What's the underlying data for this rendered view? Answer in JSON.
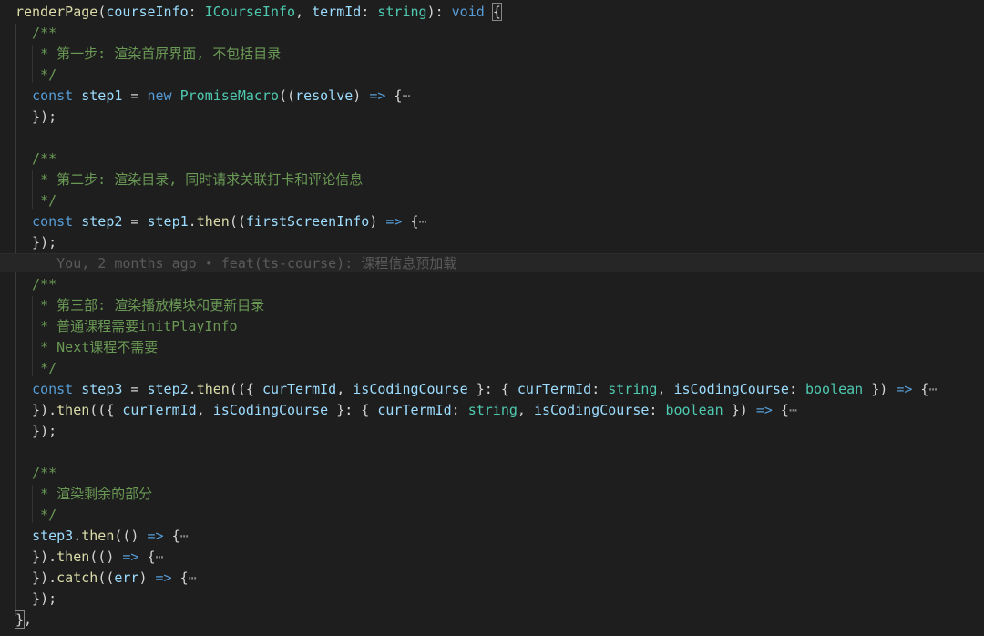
{
  "code": {
    "lines": [
      [
        {
          "t": "renderPage",
          "c": "fn"
        },
        {
          "t": "(",
          "c": "pu"
        },
        {
          "t": "courseInfo",
          "c": "vr"
        },
        {
          "t": ": ",
          "c": "pu"
        },
        {
          "t": "ICourseInfo",
          "c": "ty"
        },
        {
          "t": ", ",
          "c": "pu"
        },
        {
          "t": "termId",
          "c": "vr"
        },
        {
          "t": ": ",
          "c": "pu"
        },
        {
          "t": "string",
          "c": "ty"
        },
        {
          "t": "): ",
          "c": "pu"
        },
        {
          "t": "void",
          "c": "kw"
        },
        {
          "t": " ",
          "c": "pu"
        },
        {
          "t": "{",
          "c": "pu brace-match"
        }
      ],
      [
        {
          "t": "  /**",
          "c": "cm"
        }
      ],
      [
        {
          "t": "   * 第一步: 渲染首屏界面, 不包括目录",
          "c": "cm"
        }
      ],
      [
        {
          "t": "   */",
          "c": "cm"
        }
      ],
      [
        {
          "t": "  ",
          "c": "pu"
        },
        {
          "t": "const",
          "c": "kw"
        },
        {
          "t": " ",
          "c": "pu"
        },
        {
          "t": "step1",
          "c": "vr"
        },
        {
          "t": " = ",
          "c": "pu"
        },
        {
          "t": "new",
          "c": "kw"
        },
        {
          "t": " ",
          "c": "pu"
        },
        {
          "t": "PromiseMacro",
          "c": "ty"
        },
        {
          "t": "((",
          "c": "pu"
        },
        {
          "t": "resolve",
          "c": "vr"
        },
        {
          "t": ") ",
          "c": "pu"
        },
        {
          "t": "=>",
          "c": "op"
        },
        {
          "t": " {",
          "c": "pu"
        },
        {
          "t": "⋯",
          "c": "fold"
        }
      ],
      [
        {
          "t": "  });",
          "c": "pu"
        }
      ],
      [
        {
          "t": "",
          "c": "pu"
        }
      ],
      [
        {
          "t": "  /**",
          "c": "cm"
        }
      ],
      [
        {
          "t": "   * 第二步: 渲染目录, 同时请求关联打卡和评论信息",
          "c": "cm"
        }
      ],
      [
        {
          "t": "   */",
          "c": "cm"
        }
      ],
      [
        {
          "t": "  ",
          "c": "pu"
        },
        {
          "t": "const",
          "c": "kw"
        },
        {
          "t": " ",
          "c": "pu"
        },
        {
          "t": "step2",
          "c": "vr"
        },
        {
          "t": " = ",
          "c": "pu"
        },
        {
          "t": "step1",
          "c": "vr"
        },
        {
          "t": ".",
          "c": "pu"
        },
        {
          "t": "then",
          "c": "fn"
        },
        {
          "t": "((",
          "c": "pu"
        },
        {
          "t": "firstScreenInfo",
          "c": "vr"
        },
        {
          "t": ") ",
          "c": "pu"
        },
        {
          "t": "=>",
          "c": "op"
        },
        {
          "t": " {",
          "c": "pu"
        },
        {
          "t": "⋯",
          "c": "fold"
        }
      ],
      [
        {
          "t": "  });",
          "c": "pu"
        }
      ],
      [
        {
          "t": "     You, 2 months ago • feat(ts-course): 课程信息预加载",
          "c": "blame"
        }
      ],
      [
        {
          "t": "  /**",
          "c": "cm"
        }
      ],
      [
        {
          "t": "   * 第三部: 渲染播放模块和更新目录",
          "c": "cm"
        }
      ],
      [
        {
          "t": "   * 普通课程需要initPlayInfo",
          "c": "cm"
        }
      ],
      [
        {
          "t": "   * Next课程不需要",
          "c": "cm"
        }
      ],
      [
        {
          "t": "   */",
          "c": "cm"
        }
      ],
      [
        {
          "t": "  ",
          "c": "pu"
        },
        {
          "t": "const",
          "c": "kw"
        },
        {
          "t": " ",
          "c": "pu"
        },
        {
          "t": "step3",
          "c": "vr"
        },
        {
          "t": " = ",
          "c": "pu"
        },
        {
          "t": "step2",
          "c": "vr"
        },
        {
          "t": ".",
          "c": "pu"
        },
        {
          "t": "then",
          "c": "fn"
        },
        {
          "t": "(({ ",
          "c": "pu"
        },
        {
          "t": "curTermId",
          "c": "vr"
        },
        {
          "t": ", ",
          "c": "pu"
        },
        {
          "t": "isCodingCourse",
          "c": "vr"
        },
        {
          "t": " }: { ",
          "c": "pu"
        },
        {
          "t": "curTermId",
          "c": "vr"
        },
        {
          "t": ": ",
          "c": "pu"
        },
        {
          "t": "string",
          "c": "ty"
        },
        {
          "t": ", ",
          "c": "pu"
        },
        {
          "t": "isCodingCourse",
          "c": "vr"
        },
        {
          "t": ": ",
          "c": "pu"
        },
        {
          "t": "boolean",
          "c": "ty"
        },
        {
          "t": " }) ",
          "c": "pu"
        },
        {
          "t": "=>",
          "c": "op"
        },
        {
          "t": " {",
          "c": "pu"
        },
        {
          "t": "⋯",
          "c": "fold"
        }
      ],
      [
        {
          "t": "  }).",
          "c": "pu"
        },
        {
          "t": "then",
          "c": "fn"
        },
        {
          "t": "(({ ",
          "c": "pu"
        },
        {
          "t": "curTermId",
          "c": "vr"
        },
        {
          "t": ", ",
          "c": "pu"
        },
        {
          "t": "isCodingCourse",
          "c": "vr"
        },
        {
          "t": " }: { ",
          "c": "pu"
        },
        {
          "t": "curTermId",
          "c": "vr"
        },
        {
          "t": ": ",
          "c": "pu"
        },
        {
          "t": "string",
          "c": "ty"
        },
        {
          "t": ", ",
          "c": "pu"
        },
        {
          "t": "isCodingCourse",
          "c": "vr"
        },
        {
          "t": ": ",
          "c": "pu"
        },
        {
          "t": "boolean",
          "c": "ty"
        },
        {
          "t": " }) ",
          "c": "pu"
        },
        {
          "t": "=>",
          "c": "op"
        },
        {
          "t": " {",
          "c": "pu"
        },
        {
          "t": "⋯",
          "c": "fold"
        }
      ],
      [
        {
          "t": "  });",
          "c": "pu"
        }
      ],
      [
        {
          "t": "",
          "c": "pu"
        }
      ],
      [
        {
          "t": "  /**",
          "c": "cm"
        }
      ],
      [
        {
          "t": "   * 渲染剩余的部分",
          "c": "cm"
        }
      ],
      [
        {
          "t": "   */",
          "c": "cm"
        }
      ],
      [
        {
          "t": "  ",
          "c": "pu"
        },
        {
          "t": "step3",
          "c": "vr"
        },
        {
          "t": ".",
          "c": "pu"
        },
        {
          "t": "then",
          "c": "fn"
        },
        {
          "t": "(() ",
          "c": "pu"
        },
        {
          "t": "=>",
          "c": "op"
        },
        {
          "t": " {",
          "c": "pu"
        },
        {
          "t": "⋯",
          "c": "fold"
        }
      ],
      [
        {
          "t": "  }).",
          "c": "pu"
        },
        {
          "t": "then",
          "c": "fn"
        },
        {
          "t": "(() ",
          "c": "pu"
        },
        {
          "t": "=>",
          "c": "op"
        },
        {
          "t": " {",
          "c": "pu"
        },
        {
          "t": "⋯",
          "c": "fold"
        }
      ],
      [
        {
          "t": "  }).",
          "c": "pu"
        },
        {
          "t": "catch",
          "c": "fn"
        },
        {
          "t": "((",
          "c": "pu"
        },
        {
          "t": "err",
          "c": "vr"
        },
        {
          "t": ") ",
          "c": "pu"
        },
        {
          "t": "=>",
          "c": "op"
        },
        {
          "t": " {",
          "c": "pu"
        },
        {
          "t": "⋯",
          "c": "fold"
        }
      ],
      [
        {
          "t": "  });",
          "c": "pu"
        }
      ],
      [
        {
          "t": "}",
          "c": "pu brace-match"
        },
        {
          "t": ",",
          "c": "pu"
        }
      ]
    ],
    "current_line_index": 12
  }
}
